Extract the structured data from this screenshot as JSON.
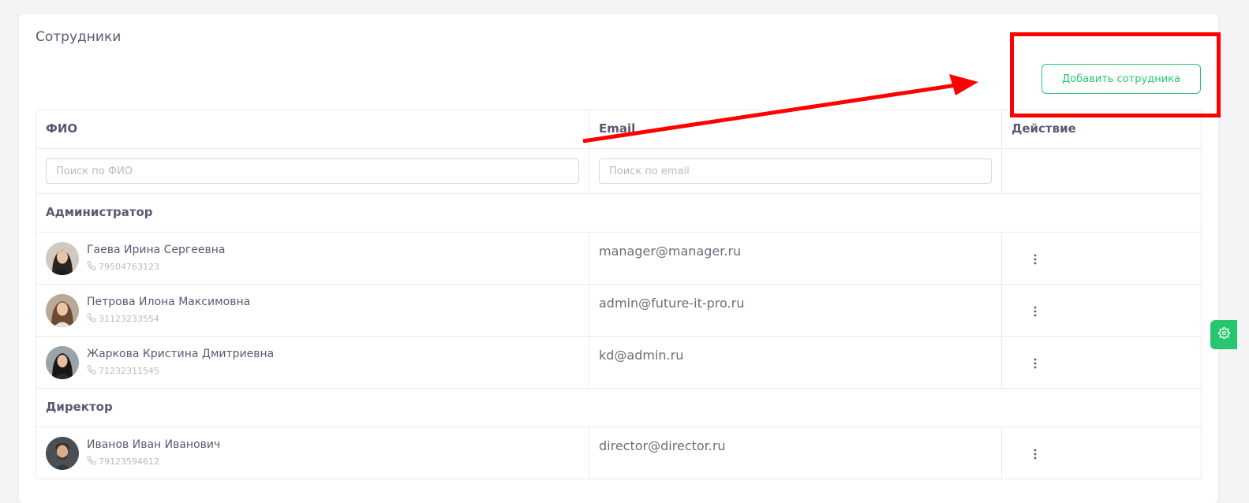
{
  "page": {
    "title": "Сотрудники"
  },
  "toolbar": {
    "add_label": "Добавить сотрудника"
  },
  "table": {
    "headers": {
      "name": "ФИО",
      "email": "Email",
      "action": "Действие"
    },
    "filters": {
      "name_placeholder": "Поиск по ФИО",
      "email_placeholder": "Поиск по email"
    },
    "groups": [
      {
        "title": "Администратор",
        "rows": [
          {
            "name": "Гаева Ирина Сергеевна",
            "phone": "79504763123",
            "email": "manager@manager.ru"
          },
          {
            "name": "Петрова Илона Максимовна",
            "phone": "31123233554",
            "email": "admin@future-it-pro.ru"
          },
          {
            "name": "Жаркова Кристина Дмитриевна",
            "phone": "71232311545",
            "email": "kd@admin.ru"
          }
        ]
      },
      {
        "title": "Директор",
        "rows": [
          {
            "name": "Иванов Иван Иванович",
            "phone": "79123594612",
            "email": "director@director.ru"
          }
        ]
      }
    ]
  },
  "icons": {
    "phone": "phone-icon",
    "more": "more-vertical-icon",
    "settings": "gear-icon"
  },
  "colors": {
    "accent": "#28c76f",
    "annotation": "#ff0000",
    "text": "#5e5873"
  }
}
